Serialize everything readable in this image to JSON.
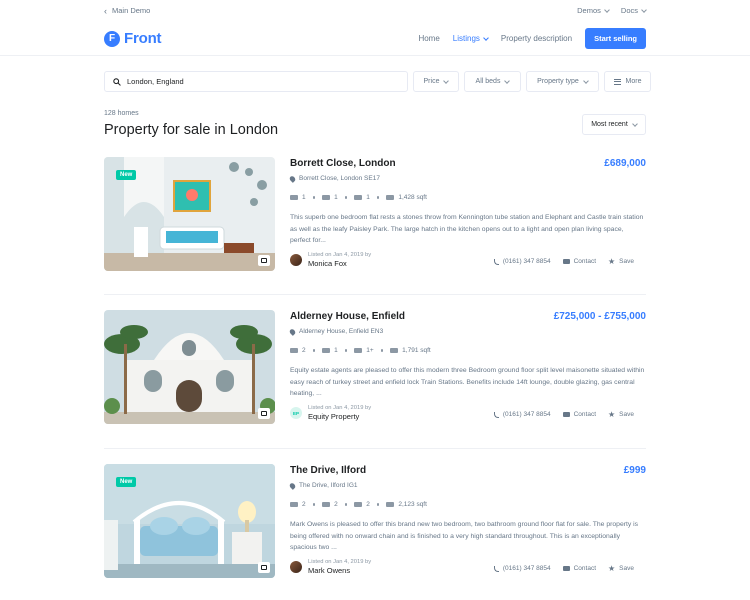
{
  "topbar": {
    "back_label": "Main Demo",
    "demos_label": "Demos",
    "docs_label": "Docs"
  },
  "header": {
    "logo_letter": "F",
    "logo_text": "Front",
    "nav": {
      "home": "Home",
      "listings": "Listings",
      "property_description": "Property description"
    },
    "cta": "Start selling"
  },
  "filters": {
    "search_value": "London, England",
    "price": "Price",
    "beds": "All beds",
    "property_type": "Property type",
    "more": "More"
  },
  "results": {
    "count": "128 homes",
    "title": "Property for sale in London",
    "sort": "Most recent"
  },
  "listings": [
    {
      "badge": "New",
      "title": "Borrett Close, London",
      "price": "£689,000",
      "address": "Borrett Close, London SE17",
      "beds": "1",
      "baths": "1",
      "cars": "1",
      "area": "1,428 sqft",
      "description": "This superb one bedroom flat rests a stones throw from Kennington tube station and Elephant and Castle train station as well as the leafy Paisley Park. The large hatch in the kitchen opens out to a light and open plan living space, perfect for...",
      "listed": "Listed on Jan 4, 2019 by",
      "agent": "Monica Fox",
      "phone": "(0161) 347 8854",
      "contact": "Contact",
      "save": "Save"
    },
    {
      "badge": "",
      "title": "Alderney House, Enfield",
      "price": "£725,000 - £755,000",
      "address": "Alderney House, Enfield EN3",
      "beds": "2",
      "baths": "1",
      "cars": "1+",
      "area": "1,791 sqft",
      "description": "Equity estate agents are pleased to offer this modern three Bedroom ground floor split level maisonette situated within easy reach of turkey street and enfield lock Train Stations. Benefits include 14ft lounge, double glazing, gas central heating, ...",
      "listed": "Listed on Jan 4, 2019 by",
      "agent_initials": "EP",
      "agent": "Equity Property",
      "phone": "(0161) 347 8854",
      "contact": "Contact",
      "save": "Save"
    },
    {
      "badge": "New",
      "title": "The Drive, Ilford",
      "price": "£999",
      "address": "The Drive, Ilford IG1",
      "beds": "2",
      "baths": "2",
      "cars": "2",
      "area": "2,123 sqft",
      "description": "Mark Owens is pleased to offer this brand new two bedroom, two bathroom ground floor flat for sale. The property is being offered with no onward chain and is finished to a very high standard throughout. This is an exceptionally spacious two ...",
      "listed": "Listed on Jan 4, 2019 by",
      "agent": "Mark Owens",
      "phone": "(0161) 347 8854",
      "contact": "Contact",
      "save": "Save"
    }
  ],
  "colors": {
    "primary": "#377dff",
    "success": "#00c9a7",
    "text": "#1e2022",
    "muted": "#677788"
  }
}
